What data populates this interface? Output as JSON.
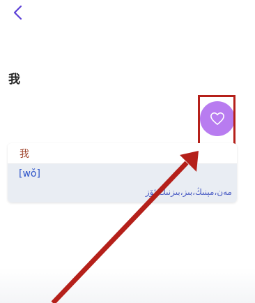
{
  "header": {
    "back_icon": "chevron-left-icon"
  },
  "page": {
    "title": "我"
  },
  "favorite": {
    "icon": "heart-outline-icon",
    "color": "#b87cf0"
  },
  "entry_card": {
    "word": "我",
    "pinyin": "[wǒ]",
    "meaning": "مەن،مېنىڭ،بىز،بىزنىڭ،ئۆز"
  },
  "annotation": {
    "highlight_color": "#b5201a",
    "arrow_color": "#b5201a"
  }
}
